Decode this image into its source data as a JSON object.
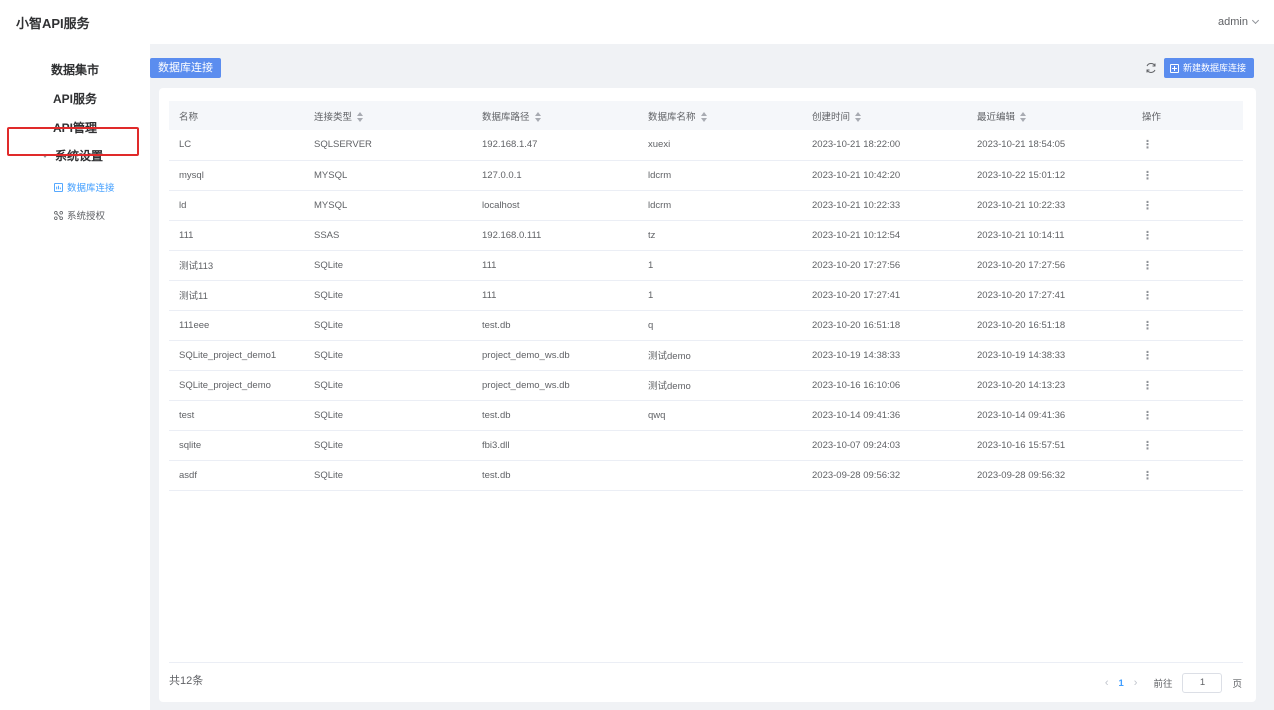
{
  "app": {
    "title": "小智API服务",
    "user": "admin"
  },
  "sidebar": {
    "items": [
      {
        "label": "数据集市"
      },
      {
        "label": "API服务"
      },
      {
        "label": "API管理"
      }
    ],
    "group": {
      "label": "系统设置",
      "children": [
        {
          "label": "数据库连接",
          "icon": "database-icon",
          "active": true
        },
        {
          "label": "系统授权",
          "icon": "network-icon",
          "active": false
        }
      ]
    }
  },
  "page": {
    "tag": "数据库连接",
    "new_button": "新建数据库连接"
  },
  "table": {
    "columns": [
      "名称",
      "连接类型",
      "数据库路径",
      "数据库名称",
      "创建时间",
      "最近编辑",
      "操作"
    ],
    "rows": [
      [
        "LC",
        "SQLSERVER",
        "192.168.1.47",
        "xuexi",
        "2023-10-21 18:22:00",
        "2023-10-21 18:54:05"
      ],
      [
        "mysql",
        "MYSQL",
        "127.0.0.1",
        "ldcrm",
        "2023-10-21 10:42:20",
        "2023-10-22 15:01:12"
      ],
      [
        "ld",
        "MYSQL",
        "localhost",
        "ldcrm",
        "2023-10-21 10:22:33",
        "2023-10-21 10:22:33"
      ],
      [
        "111",
        "SSAS",
        "192.168.0.111",
        "tz",
        "2023-10-21 10:12:54",
        "2023-10-21 10:14:11"
      ],
      [
        "测试113",
        "SQLite",
        "111",
        "1",
        "2023-10-20 17:27:56",
        "2023-10-20 17:27:56"
      ],
      [
        "测试11",
        "SQLite",
        "111",
        "1",
        "2023-10-20 17:27:41",
        "2023-10-20 17:27:41"
      ],
      [
        "111eee",
        "SQLite",
        "test.db",
        "q",
        "2023-10-20 16:51:18",
        "2023-10-20 16:51:18"
      ],
      [
        "SQLite_project_demo1",
        "SQLite",
        "project_demo_ws.db",
        "测试demo",
        "2023-10-19 14:38:33",
        "2023-10-19 14:38:33"
      ],
      [
        "SQLite_project_demo",
        "SQLite",
        "project_demo_ws.db",
        "测试demo",
        "2023-10-16 16:10:06",
        "2023-10-20 14:13:23"
      ],
      [
        "test",
        "SQLite",
        "test.db",
        "qwq",
        "2023-10-14 09:41:36",
        "2023-10-14 09:41:36"
      ],
      [
        "sqlite",
        "SQLite",
        "fbi3.dll",
        "",
        "2023-10-07 09:24:03",
        "2023-10-16 15:57:51"
      ],
      [
        "asdf",
        "SQLite",
        "test.db",
        "",
        "2023-09-28 09:56:32",
        "2023-09-28 09:56:32"
      ]
    ],
    "row_action_icon": "⋮"
  },
  "pagination": {
    "total": "共12条",
    "current_page": "1",
    "goto_label": "前往",
    "goto_value": "1",
    "page_suffix": "页"
  },
  "colors": {
    "accent": "#5b8def",
    "highlight": "#e02a2a",
    "active_text": "#409eff"
  }
}
